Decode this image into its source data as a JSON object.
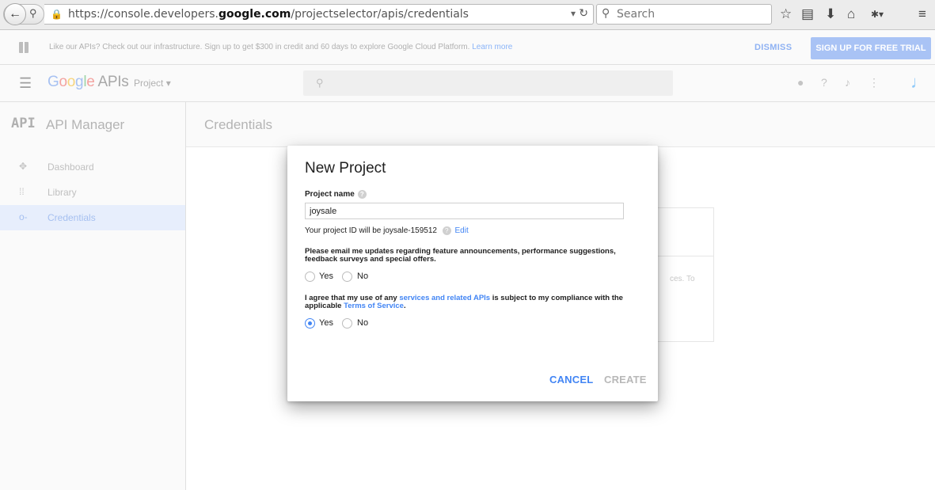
{
  "browser": {
    "url_prefix": "https://console.developers.",
    "url_domain": "google.com",
    "url_path": "/projectselector/apis/credentials",
    "search_placeholder": "Search"
  },
  "promo": {
    "text": "Like our APIs? Check out our infrastructure. Sign up to get $300 in credit and 60 days to explore Google Cloud Platform.",
    "link": "Learn more",
    "dismiss": "DISMISS",
    "trial": "SIGN UP FOR FREE TRIAL"
  },
  "header": {
    "logo_google": "Google",
    "logo_apis": "APIs",
    "project": "Project"
  },
  "sidebar": {
    "logo": "API",
    "title": "API Manager",
    "items": [
      {
        "label": "Dashboard",
        "icon": "dashboard-icon"
      },
      {
        "label": "Library",
        "icon": "library-icon"
      },
      {
        "label": "Credentials",
        "icon": "key-icon",
        "active": true
      }
    ]
  },
  "main": {
    "title": "Credentials",
    "bg_card_text": "ces. To"
  },
  "dialog": {
    "title": "New Project",
    "name_label": "Project name",
    "name_value": "joysale",
    "project_id_text": "Your project ID will be joysale-159512",
    "edit": "Edit",
    "q1": "Please email me updates regarding feature announcements, performance suggestions, feedback surveys and special offers.",
    "q1_yes": "Yes",
    "q1_no": "No",
    "q2_before": "I agree that my use of any ",
    "q2_link1": "services and related APIs",
    "q2_middle": " is subject to my compliance with the applicable ",
    "q2_link2": "Terms of Service",
    "q2_after": ".",
    "q2_yes": "Yes",
    "q2_no": "No",
    "cancel": "CANCEL",
    "create": "CREATE"
  }
}
